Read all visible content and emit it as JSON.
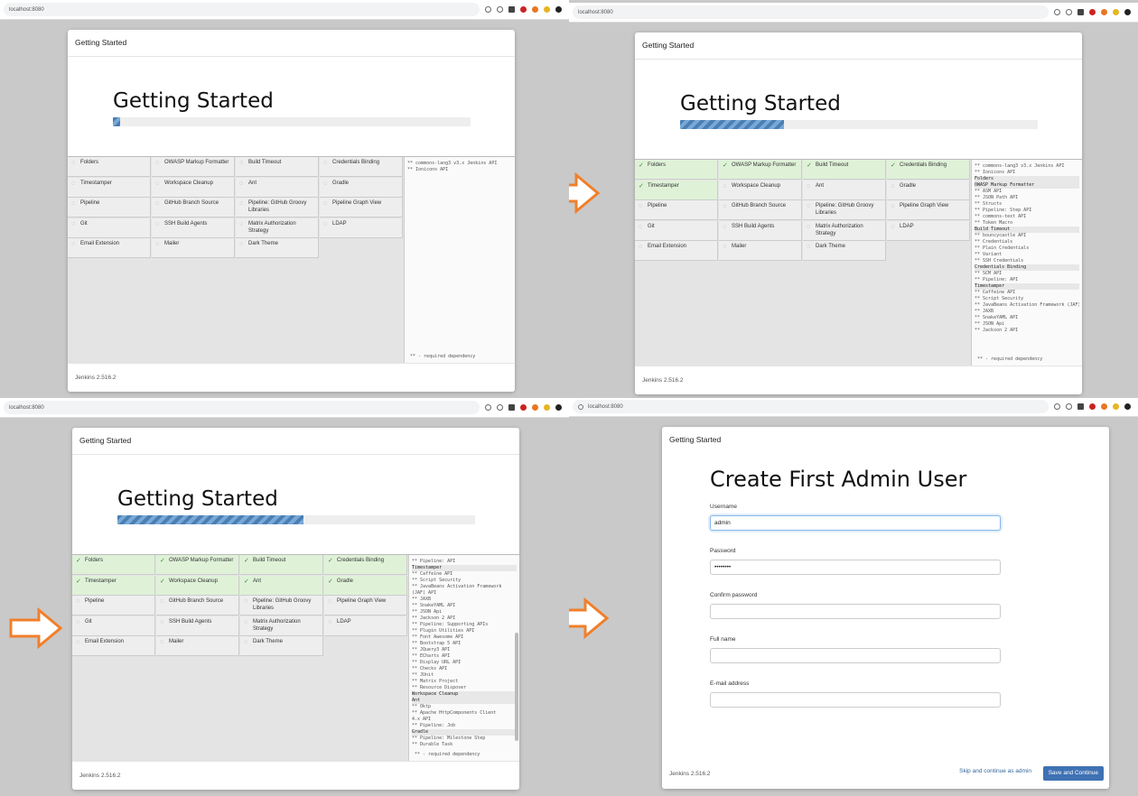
{
  "colors": {
    "accent": "#3f72b4",
    "done": "#dff2d8",
    "arrow": "#f07f2a"
  },
  "screens": [
    {
      "url": "localhost:8080",
      "header": "Getting Started",
      "hero_title": "Getting Started",
      "progress": 0.02,
      "plugins": [
        {
          "label": "Folders",
          "state": "pending"
        },
        {
          "label": "OWASP Markup Formatter",
          "state": "pending"
        },
        {
          "label": "Build Timeout",
          "state": "pending"
        },
        {
          "label": "Credentials Binding",
          "state": "pending"
        },
        {
          "label": "Timestamper",
          "state": "pending"
        },
        {
          "label": "Workspace Cleanup",
          "state": "pending"
        },
        {
          "label": "Ant",
          "state": "pending"
        },
        {
          "label": "Gradle",
          "state": "pending"
        },
        {
          "label": "Pipeline",
          "state": "pending"
        },
        {
          "label": "GitHub Branch Source",
          "state": "pending"
        },
        {
          "label": "Pipeline: GitHub Groovy Libraries",
          "state": "pending"
        },
        {
          "label": "Pipeline Graph View",
          "state": "pending"
        },
        {
          "label": "Git",
          "state": "pending"
        },
        {
          "label": "SSH Build Agents",
          "state": "pending"
        },
        {
          "label": "Matrix Authorization Strategy",
          "state": "pending"
        },
        {
          "label": "LDAP",
          "state": "pending"
        },
        {
          "label": "Email Extension",
          "state": "pending"
        },
        {
          "label": "Mailer",
          "state": "pending"
        },
        {
          "label": "Dark Theme",
          "state": "pending"
        }
      ],
      "log_lines": [
        {
          "text": "** commons-lang3 v3.x Jenkins API",
          "header": false
        },
        {
          "text": "** Ionicons API",
          "header": false
        }
      ],
      "legend": "** - required dependency",
      "footer": "Jenkins 2.516.2"
    },
    {
      "url": "localhost:8080",
      "header": "Getting Started",
      "hero_title": "Getting Started",
      "progress": 0.29,
      "plugins": [
        {
          "label": "Folders",
          "state": "done"
        },
        {
          "label": "OWASP Markup Formatter",
          "state": "done"
        },
        {
          "label": "Build Timeout",
          "state": "done"
        },
        {
          "label": "Credentials Binding",
          "state": "done"
        },
        {
          "label": "Timestamper",
          "state": "done"
        },
        {
          "label": "Workspace Cleanup",
          "state": "pending"
        },
        {
          "label": "Ant",
          "state": "pending"
        },
        {
          "label": "Gradle",
          "state": "pending"
        },
        {
          "label": "Pipeline",
          "state": "pending"
        },
        {
          "label": "GitHub Branch Source",
          "state": "pending"
        },
        {
          "label": "Pipeline: GitHub Groovy Libraries",
          "state": "pending"
        },
        {
          "label": "Pipeline Graph View",
          "state": "pending"
        },
        {
          "label": "Git",
          "state": "pending"
        },
        {
          "label": "SSH Build Agents",
          "state": "pending"
        },
        {
          "label": "Matrix Authorization Strategy",
          "state": "pending"
        },
        {
          "label": "LDAP",
          "state": "pending"
        },
        {
          "label": "Email Extension",
          "state": "pending"
        },
        {
          "label": "Mailer",
          "state": "pending"
        },
        {
          "label": "Dark Theme",
          "state": "pending"
        }
      ],
      "log_lines": [
        {
          "text": "** commons-lang3 v3.x Jenkins API",
          "header": false
        },
        {
          "text": "** Ionicons API",
          "header": false
        },
        {
          "text": "Folders",
          "header": true
        },
        {
          "text": "OWASP Markup Formatter",
          "header": true
        },
        {
          "text": "** ASM API",
          "header": false
        },
        {
          "text": "** JSON Path API",
          "header": false
        },
        {
          "text": "** Structs",
          "header": false
        },
        {
          "text": "** Pipeline: Step API",
          "header": false
        },
        {
          "text": "** commons-text API",
          "header": false
        },
        {
          "text": "** Token Macro",
          "header": false
        },
        {
          "text": "Build Timeout",
          "header": true
        },
        {
          "text": "** bouncycastle API",
          "header": false
        },
        {
          "text": "** Credentials",
          "header": false
        },
        {
          "text": "** Plain Credentials",
          "header": false
        },
        {
          "text": "** Variant",
          "header": false
        },
        {
          "text": "** SSH Credentials",
          "header": false
        },
        {
          "text": "Credentials Binding",
          "header": true
        },
        {
          "text": "** SCM API",
          "header": false
        },
        {
          "text": "** Pipeline: API",
          "header": false
        },
        {
          "text": "Timestamper",
          "header": true
        },
        {
          "text": "** Caffeine API",
          "header": false
        },
        {
          "text": "** Script Security",
          "header": false
        },
        {
          "text": "** JavaBeans Activation Framework (JAF) API",
          "header": false
        },
        {
          "text": "** JAXB",
          "header": false
        },
        {
          "text": "** SnakeYAML API",
          "header": false
        },
        {
          "text": "** JSON Api",
          "header": false
        },
        {
          "text": "** Jackson 2 API",
          "header": false
        }
      ],
      "legend": "** - required dependency",
      "footer": "Jenkins 2.516.2"
    },
    {
      "url": "localhost:8080",
      "header": "Getting Started",
      "hero_title": "Getting Started",
      "progress": 0.52,
      "plugins": [
        {
          "label": "Folders",
          "state": "done"
        },
        {
          "label": "OWASP Markup Formatter",
          "state": "done"
        },
        {
          "label": "Build Timeout",
          "state": "done"
        },
        {
          "label": "Credentials Binding",
          "state": "done"
        },
        {
          "label": "Timestamper",
          "state": "done"
        },
        {
          "label": "Workspace Cleanup",
          "state": "done"
        },
        {
          "label": "Ant",
          "state": "done"
        },
        {
          "label": "Gradle",
          "state": "done"
        },
        {
          "label": "Pipeline",
          "state": "pending"
        },
        {
          "label": "GitHub Branch Source",
          "state": "pending"
        },
        {
          "label": "Pipeline: GitHub Groovy Libraries",
          "state": "pending"
        },
        {
          "label": "Pipeline Graph View",
          "state": "pending"
        },
        {
          "label": "Git",
          "state": "pending"
        },
        {
          "label": "SSH Build Agents",
          "state": "pending"
        },
        {
          "label": "Matrix Authorization Strategy",
          "state": "pending"
        },
        {
          "label": "LDAP",
          "state": "pending"
        },
        {
          "label": "Email Extension",
          "state": "pending"
        },
        {
          "label": "Mailer",
          "state": "pending"
        },
        {
          "label": "Dark Theme",
          "state": "pending"
        }
      ],
      "log_lines": [
        {
          "text": "** Pipeline: API",
          "header": false
        },
        {
          "text": "Timestamper",
          "header": true
        },
        {
          "text": "** Caffeine API",
          "header": false
        },
        {
          "text": "** Script Security",
          "header": false
        },
        {
          "text": "** JavaBeans Activation Framework",
          "header": false
        },
        {
          "text": "(JAF) API",
          "header": false
        },
        {
          "text": "** JAXB",
          "header": false
        },
        {
          "text": "** SnakeYAML API",
          "header": false
        },
        {
          "text": "** JSON Api",
          "header": false
        },
        {
          "text": "** Jackson 2 API",
          "header": false
        },
        {
          "text": "** Pipeline: Supporting APIs",
          "header": false
        },
        {
          "text": "** Plugin Utilities API",
          "header": false
        },
        {
          "text": "** Font Awesome API",
          "header": false
        },
        {
          "text": "** Bootstrap 5 API",
          "header": false
        },
        {
          "text": "** JQuery3 API",
          "header": false
        },
        {
          "text": "** ECharts API",
          "header": false
        },
        {
          "text": "** Display URL API",
          "header": false
        },
        {
          "text": "** Checks API",
          "header": false
        },
        {
          "text": "** JUnit",
          "header": false
        },
        {
          "text": "** Matrix Project",
          "header": false
        },
        {
          "text": "** Resource Disposer",
          "header": false
        },
        {
          "text": "Workspace Cleanup",
          "header": true
        },
        {
          "text": "Ant",
          "header": true
        },
        {
          "text": "** Oktp",
          "header": false
        },
        {
          "text": "** Apache HttpComponents Client",
          "header": false
        },
        {
          "text": "4.x API",
          "header": false
        },
        {
          "text": "** Pipeline: Job",
          "header": false
        },
        {
          "text": "Gradle",
          "header": true
        },
        {
          "text": "** Pipeline: Milestone Step",
          "header": false
        },
        {
          "text": "** Durable Task",
          "header": false
        }
      ],
      "legend": "** - required dependency",
      "footer": "Jenkins 2.516.2"
    }
  ],
  "admin": {
    "url": "localhost:8080",
    "header": "Getting Started",
    "title": "Create First Admin User",
    "fields": [
      {
        "label": "Username",
        "value": "admin"
      },
      {
        "label": "Password",
        "value": "••••••••"
      },
      {
        "label": "Confirm password",
        "value": ""
      },
      {
        "label": "Full name",
        "value": ""
      },
      {
        "label": "E-mail address",
        "value": ""
      }
    ],
    "footer": "Jenkins 2.516.2",
    "skip_label": "Skip and continue as admin",
    "save_label": "Save and Continue"
  }
}
